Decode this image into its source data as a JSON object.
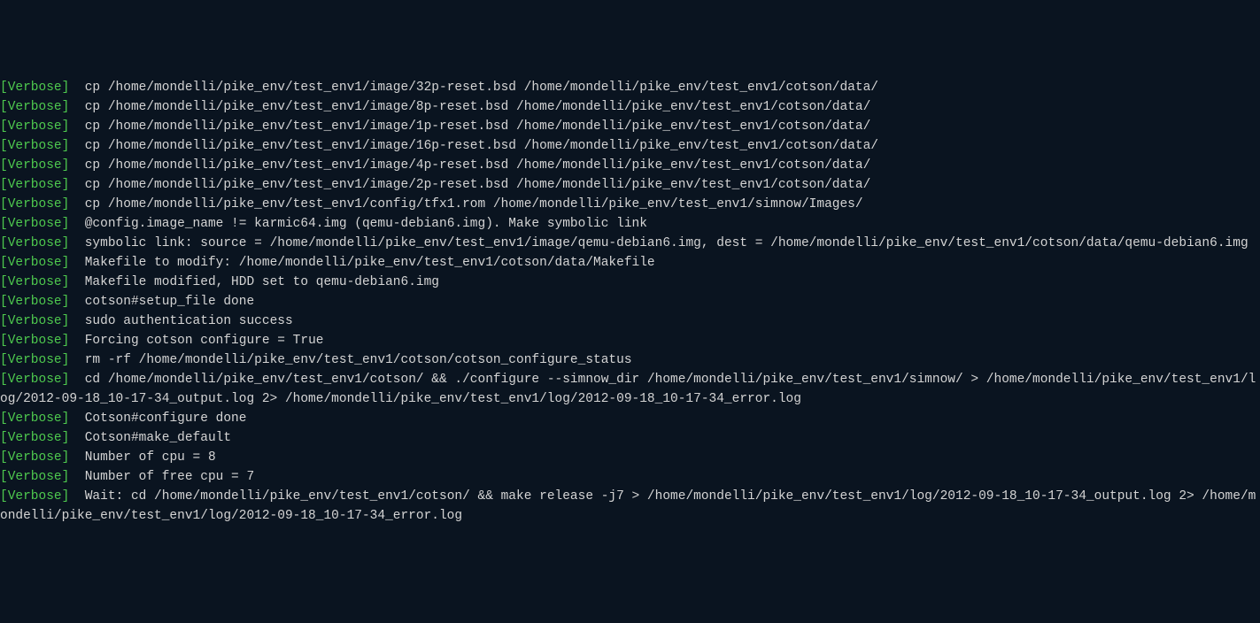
{
  "lines": [
    {
      "tag": "[Verbose]",
      "text": "  cp /home/mondelli/pike_env/test_env1/image/32p-reset.bsd /home/mondelli/pike_env/test_env1/cotson/data/"
    },
    {
      "tag": "[Verbose]",
      "text": "  cp /home/mondelli/pike_env/test_env1/image/8p-reset.bsd /home/mondelli/pike_env/test_env1/cotson/data/"
    },
    {
      "tag": "[Verbose]",
      "text": "  cp /home/mondelli/pike_env/test_env1/image/1p-reset.bsd /home/mondelli/pike_env/test_env1/cotson/data/"
    },
    {
      "tag": "[Verbose]",
      "text": "  cp /home/mondelli/pike_env/test_env1/image/16p-reset.bsd /home/mondelli/pike_env/test_env1/cotson/data/"
    },
    {
      "tag": "[Verbose]",
      "text": "  cp /home/mondelli/pike_env/test_env1/image/4p-reset.bsd /home/mondelli/pike_env/test_env1/cotson/data/"
    },
    {
      "tag": "[Verbose]",
      "text": "  cp /home/mondelli/pike_env/test_env1/image/2p-reset.bsd /home/mondelli/pike_env/test_env1/cotson/data/"
    },
    {
      "tag": "[Verbose]",
      "text": "  cp /home/mondelli/pike_env/test_env1/config/tfx1.rom /home/mondelli/pike_env/test_env1/simnow/Images/"
    },
    {
      "tag": "[Verbose]",
      "text": "  @config.image_name != karmic64.img (qemu-debian6.img). Make symbolic link"
    },
    {
      "tag": "[Verbose]",
      "text": "  symbolic link: source = /home/mondelli/pike_env/test_env1/image/qemu-debian6.img, dest = /home/mondelli/pike_env/test_env1/cotson/data/qemu-debian6.img"
    },
    {
      "tag": "[Verbose]",
      "text": "  Makefile to modify: /home/mondelli/pike_env/test_env1/cotson/data/Makefile"
    },
    {
      "tag": "[Verbose]",
      "text": "  Makefile modified, HDD set to qemu-debian6.img"
    },
    {
      "tag": "[Verbose]",
      "text": "  cotson#setup_file done"
    },
    {
      "tag": "[Verbose]",
      "text": "  sudo authentication success"
    },
    {
      "tag": "[Verbose]",
      "text": "  Forcing cotson configure = True"
    },
    {
      "tag": "[Verbose]",
      "text": "  rm -rf /home/mondelli/pike_env/test_env1/cotson/cotson_configure_status"
    },
    {
      "tag": "[Verbose]",
      "text": "  cd /home/mondelli/pike_env/test_env1/cotson/ && ./configure --simnow_dir /home/mondelli/pike_env/test_env1/simnow/ > /home/mondelli/pike_env/test_env1/log/2012-09-18_10-17-34_output.log 2> /home/mondelli/pike_env/test_env1/log/2012-09-18_10-17-34_error.log"
    },
    {
      "tag": "[Verbose]",
      "text": "  Cotson#configure done"
    },
    {
      "tag": "[Verbose]",
      "text": "  Cotson#make_default"
    },
    {
      "tag": "[Verbose]",
      "text": "  Number of cpu = 8"
    },
    {
      "tag": "[Verbose]",
      "text": "  Number of free cpu = 7"
    },
    {
      "tag": "[Verbose]",
      "text": "  Wait: cd /home/mondelli/pike_env/test_env1/cotson/ && make release -j7 > /home/mondelli/pike_env/test_env1/log/2012-09-18_10-17-34_output.log 2> /home/mondelli/pike_env/test_env1/log/2012-09-18_10-17-34_error.log"
    }
  ]
}
